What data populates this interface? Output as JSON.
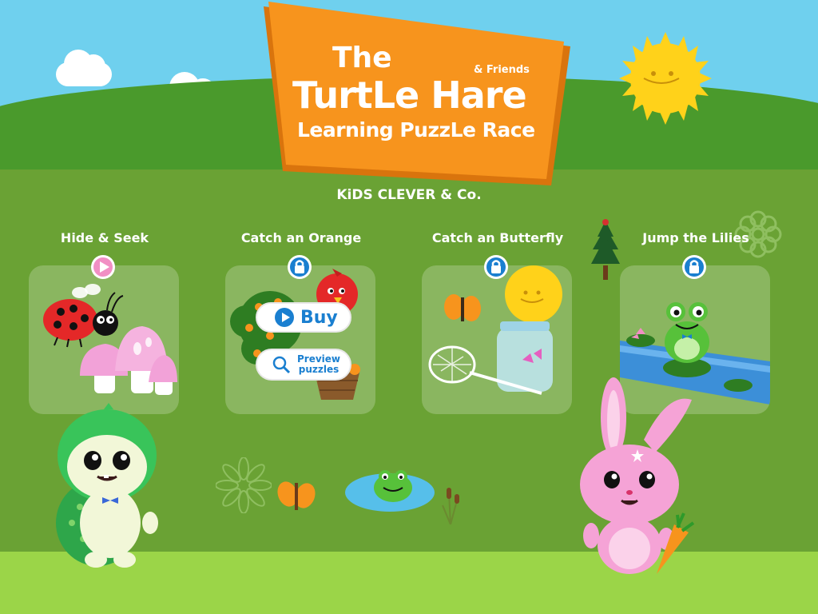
{
  "title": {
    "the": "The",
    "friends": "& Friends",
    "main": "TurtLe Hare",
    "subtitle": "Learning PuzzLe Race"
  },
  "publisher": "KiDS CLEVER & Co.",
  "games": [
    {
      "title": "Hide & Seek",
      "status_icon": "play-icon",
      "art": "ladybug-mushrooms"
    },
    {
      "title": "Catch an Orange",
      "status_icon": "lock-icon",
      "art": "orange-tree-bird-basket"
    },
    {
      "title": "Catch an Butterfly",
      "status_icon": "lock-icon",
      "art": "butterfly-net-jar"
    },
    {
      "title": "Jump the Lilies",
      "status_icon": "lock-icon",
      "art": "frog-lily-pads"
    }
  ],
  "store": {
    "buy_label": "Buy",
    "preview_label": "Preview puzzles"
  },
  "colors": {
    "sky": "#6fd0ee",
    "field": "#6aa234",
    "sign": "#f7941d",
    "accent_blue": "#1a7fd0",
    "play_pink": "#f18fc4"
  }
}
